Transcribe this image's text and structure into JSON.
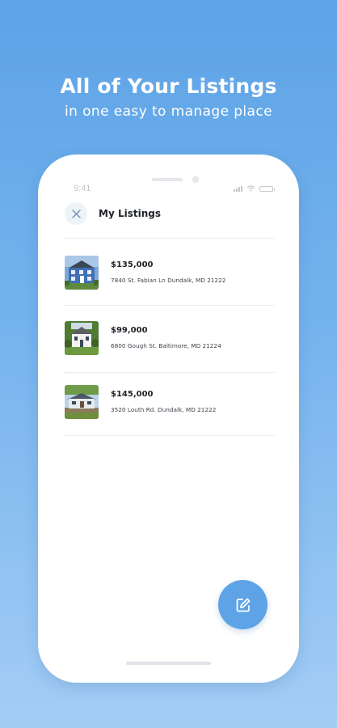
{
  "promo": {
    "headline": "All of Your Listings",
    "subline": "in one easy to manage place"
  },
  "status_bar": {
    "time": "9:41",
    "icons": [
      "signal-icon",
      "wifi-icon",
      "battery-icon"
    ]
  },
  "header": {
    "title": "My Listings",
    "close_icon": "close-icon"
  },
  "listings": [
    {
      "price": "$135,000",
      "address": "7840 St. Fabian Ln Dundalk, MD 21222"
    },
    {
      "price": "$99,000",
      "address": "6800 Gough St. Baltimore, MD 21224"
    },
    {
      "price": "$145,000",
      "address": "3520 Louth Rd. Dundalk, MD 21222"
    }
  ],
  "fab": {
    "icon": "edit-icon"
  },
  "colors": {
    "accent": "#5da3e6",
    "background_top": "#5da3e6",
    "background_bottom": "#a4cdf5"
  }
}
